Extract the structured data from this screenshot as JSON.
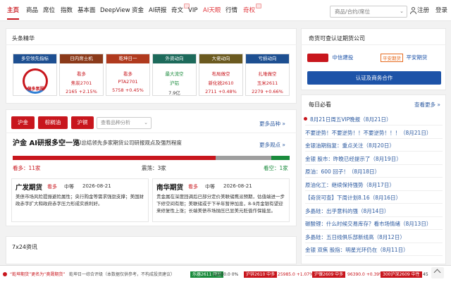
{
  "nav": {
    "items": [
      "主页",
      "商品",
      "席位",
      "指数",
      "基本面",
      "DeepView",
      "资金",
      "AI研报",
      "奇文",
      "VIP",
      "AI天眼",
      "行情",
      "奇权"
    ],
    "search_placeholder": "商品/合约/席位",
    "register": "注册",
    "login": "登录"
  },
  "headline": {
    "title": "头条精华",
    "cards": [
      {
        "header": "多空领先指标",
        "header_color": "#1d4f91",
        "l1": "",
        "l2": "",
        "l3": "偏多氛围"
      },
      {
        "header": "日内席士机",
        "header_color": "#8b3a1a",
        "l1": "看多",
        "l2": "焦炭2701",
        "l3": "2165 +2.15%"
      },
      {
        "header": "乾坤日一",
        "header_color": "#b03a1e",
        "l1": "看多",
        "l2": "PTA2701",
        "l3": "5758 +0.45%"
      },
      {
        "header": "外资动向",
        "header_color": "#1d6a5b",
        "l1": "最大流空",
        "l2": "沪铝",
        "l3": "7.9亿"
      },
      {
        "header": "大佬动向",
        "header_color": "#6b5a20",
        "l1": "布局做空",
        "l2": "新化锐2610",
        "l3": "2711 +0.48%"
      },
      {
        "header": "亏损动向",
        "header_color": "#1d4f91",
        "l1": "扎堆做空",
        "l2": "玉米2611",
        "l3": "2279 +0.66%"
      }
    ]
  },
  "partner": {
    "title": "奇货可查认证期货公司",
    "logo1": "中信建投",
    "logo2": "平安期货",
    "button": "认证及商务合作"
  },
  "ai": {
    "tabs": [
      "沪金",
      "棕榈油",
      "沪铜"
    ],
    "more_select": "查看品种分析",
    "more_varieties": "更多品种 »",
    "title": "沪金 AI研报多空一览",
    "subtitle": "AI总结领先多家期货公司研报观点及强烈程度",
    "more_views": "更多观点 »",
    "sentiment": {
      "bull": 11,
      "neutral": 3,
      "bear": 1
    },
    "bull_label": "看多：11家",
    "neutral_label": "震荡：3家",
    "bear_label": "看空：1家",
    "institutions": [
      {
        "name": "广发期货",
        "view": "看多",
        "strength": "中等",
        "date": "2026-08-21",
        "body": "美债市场风险提振避险属性；央行购金等需求强劲支撑；美国财政赤字扩大和政府赤字压力形成实质利好。"
      },
      {
        "name": "南华期货",
        "view": "看多",
        "strength": "中等",
        "date": "2026-08-21",
        "body": "贵金属在深度回调后已部分定价美联储鹰派预期，估值端进一步下修空间有限；美联储或于下半年暂停加息，8-9月金银有望迎来修复性上涨；长端美债市场抛压已显美元贬值作保能显。"
      }
    ]
  },
  "news7x24": {
    "title": "7x24资讯"
  },
  "must_read": {
    "title": "每日必看",
    "more": "查看更多 »",
    "items": [
      "8月21日周五VIP晚报（8月21日）",
      "不要逆势！不要逆势！！不要逆势！！！（8月21日）",
      "金银油期指复：重点关注（8月20日）",
      "金银 股市：昨晚已经提示了（8月19日）",
      "原油：600 回子！（8月18日）",
      "原油化工：继续保持强势（8月17日）",
      "【奇货可查】下周计划8.16（8月16日）",
      "多晶硅：出乎意料的强（8月14日）",
      "碳酸锂：什么时候交易库存？看市场情绪（8月13日）",
      "多晶硅：五日线俱乐部新线高（8月12日）",
      "金银 双焦 股指：明星光环仍在（8月11日）"
    ]
  },
  "ticker": {
    "headline": "“乾坤期货”更名为“奥晟期货”",
    "sub": "乾坤日一综合评级（本数据仅供参考，不构成投资建议）",
    "items": [
      {
        "text": "乐器2611 回空",
        "color": "#1a8b3c"
      },
      {
        "text": "12250.0  0%",
        "color": "#333"
      },
      {
        "text": "沪锌2610 中多",
        "color": "#c8161d"
      },
      {
        "text": "25985.0  +1.07%",
        "color": "#c8161d"
      },
      {
        "text": "沪镍2609 中多",
        "color": "#c8161d"
      },
      {
        "text": "96390.0  +0.39%",
        "color": "#c8161d"
      },
      {
        "text": "300沪深2609 中性",
        "color": "#c8161d"
      },
      {
        "text": "45",
        "color": "#333"
      }
    ]
  },
  "colors": {
    "brand": "#c8161d",
    "link": "#2c5aa0",
    "button": "#1d53a8",
    "bear": "#1a8b3c",
    "neutral_bar": "#9e9e9e"
  }
}
